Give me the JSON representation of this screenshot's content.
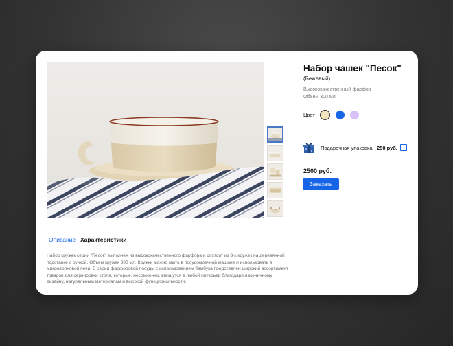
{
  "product": {
    "title": "Набор чашек \"Песок\"",
    "subtitle": "(Бежевый)",
    "desc_line1": "Высококачественный фарфор",
    "desc_line2": "Объём 300 мл",
    "color_label": "Цвет",
    "colors": [
      "#f2e4bd",
      "#1565e6",
      "#d8c1f6"
    ],
    "selected_color_index": 0,
    "gift_label": "Подарочная упаковка",
    "gift_price": "250 руб.",
    "gift_checked": false,
    "price": "2500 руб.",
    "order_button": "Заказать"
  },
  "gallery": {
    "thumbnail_count": 5,
    "active_thumbnail_index": 0
  },
  "tabs": {
    "description": "Описание",
    "specs": "Характеристики",
    "active": "description"
  },
  "description_text": "Набор кружек серии \"Песок\" выполнен из высококачественного фарфора и состоит из 3-х кружек на деревянной подставке с ручкой. Объем кружек 300 мл. Кружки можно мыть в посудомоечной машине и использовать в микроволновой печи. В серии фарфоровой посуды с использованием бамбука представлен широкий ассортимент товаров для сервировки стола, которые, несомненно, впишутся в любой интерьер благодаря лаконичному дизайну, натуральным материалам и высокой функциональности.",
  "colors": {
    "accent": "#1565e6",
    "text": "#111111",
    "muted": "#777777"
  }
}
